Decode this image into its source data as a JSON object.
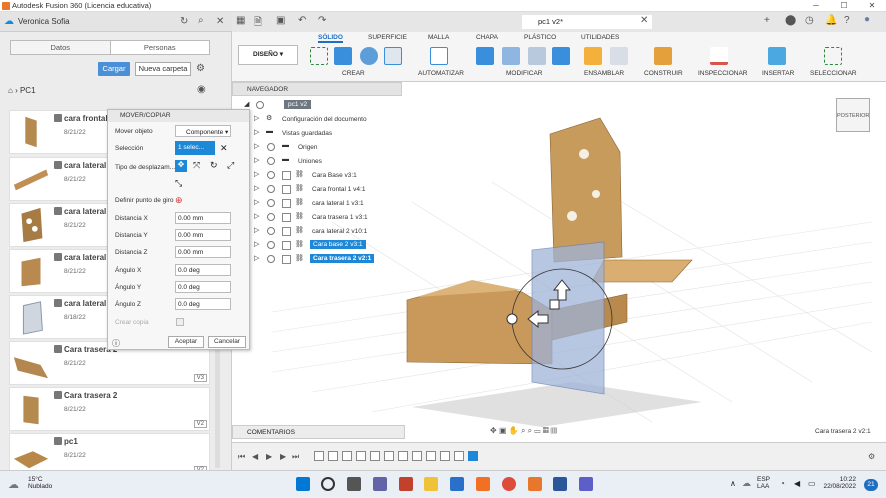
{
  "window": {
    "title": "Autodesk Fusion 360 (Licencia educativa)"
  },
  "data_panel": {
    "user": "Veronica Sofia",
    "tabs": [
      "Datos",
      "Personas"
    ],
    "upload_label": "Cargar",
    "new_folder_label": "Nueva carpeta",
    "project": "PC1",
    "files": [
      {
        "name": "cara frontal",
        "date": "8/21/22",
        "version": ""
      },
      {
        "name": "cara lateral",
        "date": "8/21/22",
        "version": ""
      },
      {
        "name": "cara lateral",
        "date": "8/21/22",
        "version": ""
      },
      {
        "name": "cara lateral",
        "date": "8/21/22",
        "version": ""
      },
      {
        "name": "cara lateral",
        "date": "8/18/22",
        "version": ""
      },
      {
        "name": "Cara trasera 2",
        "date": "8/21/22",
        "version": "V3"
      },
      {
        "name": "Cara trasera 2",
        "date": "8/21/22",
        "version": "V2"
      },
      {
        "name": "pc1",
        "date": "8/21/22",
        "version": "V2"
      }
    ]
  },
  "move_dialog": {
    "title": "MOVER/COPIAR",
    "move_object_label": "Mover objeto",
    "move_object_value": "Componente",
    "selection_label": "Selección",
    "selection_value": "1 selec...",
    "move_type_label": "Tipo de desplazam...",
    "pivot_label": "Definir punto de giro",
    "fields": [
      {
        "label": "Distancia X",
        "value": "0.00 mm"
      },
      {
        "label": "Distancia Y",
        "value": "0.00 mm"
      },
      {
        "label": "Distancia Z",
        "value": "0.00 mm"
      },
      {
        "label": "Ángulo X",
        "value": "0.0 deg"
      },
      {
        "label": "Ángulo Y",
        "value": "0.0 deg"
      },
      {
        "label": "Ángulo Z",
        "value": "0.0 deg"
      }
    ],
    "copy_label": "Crear copia",
    "ok_label": "Aceptar",
    "cancel_label": "Cancelar"
  },
  "document": {
    "tab": "pc1 v2*"
  },
  "ribbon": {
    "workspace": "DISEÑO",
    "tabs": [
      "SÓLIDO",
      "SUPERFICIE",
      "MALLA",
      "CHAPA",
      "PLÁSTICO",
      "UTILIDADES"
    ],
    "groups": [
      "CREAR",
      "AUTOMATIZAR",
      "MODIFICAR",
      "ENSAMBLAR",
      "CONSTRUIR",
      "INSPECCIONAR",
      "INSERTAR",
      "SELECCIONAR"
    ]
  },
  "browser": {
    "title": "NAVEGADOR",
    "root": "pc1 v2",
    "items": [
      {
        "label": "Configuración del documento",
        "selected": false
      },
      {
        "label": "Vistas guardadas",
        "selected": false
      },
      {
        "label": "Origen",
        "selected": false
      },
      {
        "label": "Uniones",
        "selected": false
      },
      {
        "label": "Cara Base v3:1",
        "selected": false
      },
      {
        "label": "Cara frontal 1 v4:1",
        "selected": false
      },
      {
        "label": "cara lateral 1 v3:1",
        "selected": false
      },
      {
        "label": "Cara trasera 1 v3:1",
        "selected": false
      },
      {
        "label": "cara lateral 2 v10:1",
        "selected": false
      },
      {
        "label": "Cara base 2 v3:1",
        "selected": true
      },
      {
        "label": "Cara trasera 2 v2:1",
        "selected": true
      }
    ]
  },
  "viewcube": {
    "label": "POSTERIOR"
  },
  "comments_label": "COMENTARIOS",
  "status_text": "Cara trasera 2 v2:1",
  "taskbar": {
    "weather_temp": "15°C",
    "weather_desc": "Nublado",
    "lang1": "ESP",
    "lang2": "LAA",
    "time": "10:22",
    "date": "22/08/2022",
    "notif": "21"
  },
  "colors": {
    "accent": "#1e88d8",
    "wood": "#c8a060",
    "selected_part": "#9fb3d8"
  }
}
